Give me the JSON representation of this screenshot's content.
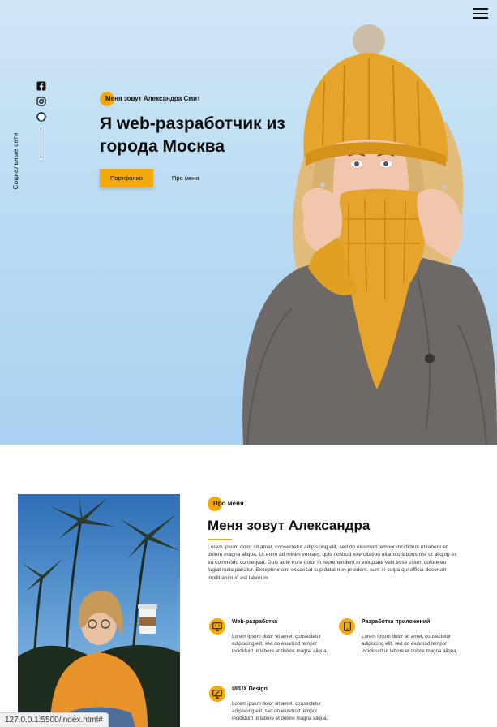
{
  "hero": {
    "subtitle": "Меня зовут Александра Смит",
    "title": "Я web-разработчик из города Москва",
    "primary_button": "Портфолио",
    "secondary_button": "Про меня",
    "social_label": "Социальные сети",
    "social_icons": [
      "facebook-icon",
      "instagram-icon",
      "github-icon"
    ]
  },
  "about": {
    "tag": "Про меня",
    "title": "Меня зовут Александра",
    "paragraph": "Lorem ipsum dolor sit amet, consectetur adipiscing elit, sed do eiusmod tempor incididunt ut labore et dolore magna aliqua. Ut enim ad minim veniam, quis nostrud exercitation ullamco laboris nisi ut aliquip ex ea commodo consequat. Duis aute irure dolor in reprehenderit in voluptate velit esse cillum dolore eu fugiat nulla pariatur. Excepteur sint occaecat cupidatat non proident, sunt in culpa qui officia deserunt mollit anim id est laborum"
  },
  "services": [
    {
      "name": "Web-разработка",
      "desc": "Lorem ipsum dolor sit amet, consectetur adipiscing elit, sed do eiusmod tempor incididunt ut labore et dolore magna aliqua."
    },
    {
      "name": "Разработка приложений",
      "desc": "Lorem ipsum dolor sit amet, consectetur adipiscing elit, sed do eiusmod tempor incididunt ut labore et dolore magna aliqua."
    },
    {
      "name": "UI/UX Design",
      "desc": "Lorem ipsum dolor sit amet, consectetur adipiscing elit, sed do eiusmod tempor incididunt ut labore et dolore magna aliqua."
    }
  ],
  "status_url": "127.0.0.1:5500/index.html#",
  "colors": {
    "accent": "#f4a90a",
    "hero_bg": "#bcdcf3",
    "sweater": "#6e6866"
  }
}
